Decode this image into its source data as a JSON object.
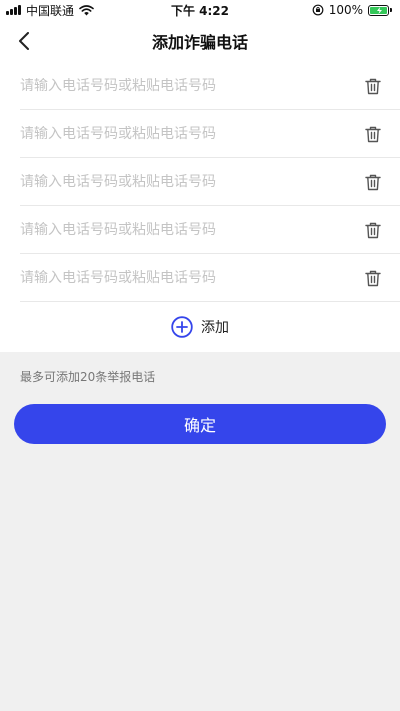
{
  "status_bar": {
    "carrier": "中国联通",
    "time": "下午 4:22",
    "battery": "100%",
    "signal_icon": "signal-bars-icon",
    "wifi_icon": "wifi-icon",
    "lock_icon": "orientation-lock-icon",
    "battery_icon": "battery-charging-icon"
  },
  "nav": {
    "title": "添加诈骗电话",
    "back_icon": "chevron-left-icon"
  },
  "phone_rows": [
    {
      "value": "",
      "placeholder": "请输入电话号码或粘贴电话号码"
    },
    {
      "value": "",
      "placeholder": "请输入电话号码或粘贴电话号码"
    },
    {
      "value": "",
      "placeholder": "请输入电话号码或粘贴电话号码"
    },
    {
      "value": "",
      "placeholder": "请输入电话号码或粘贴电话号码"
    },
    {
      "value": "",
      "placeholder": "请输入电话号码或粘贴电话号码"
    }
  ],
  "add": {
    "label": "添加",
    "icon": "plus-circle-icon"
  },
  "hint": "最多可添加20条举报电话",
  "confirm_label": "确定",
  "colors": {
    "accent": "#3545eb",
    "background": "#f0f0f0",
    "placeholder": "#c4c4c4",
    "battery": "#34c759"
  }
}
